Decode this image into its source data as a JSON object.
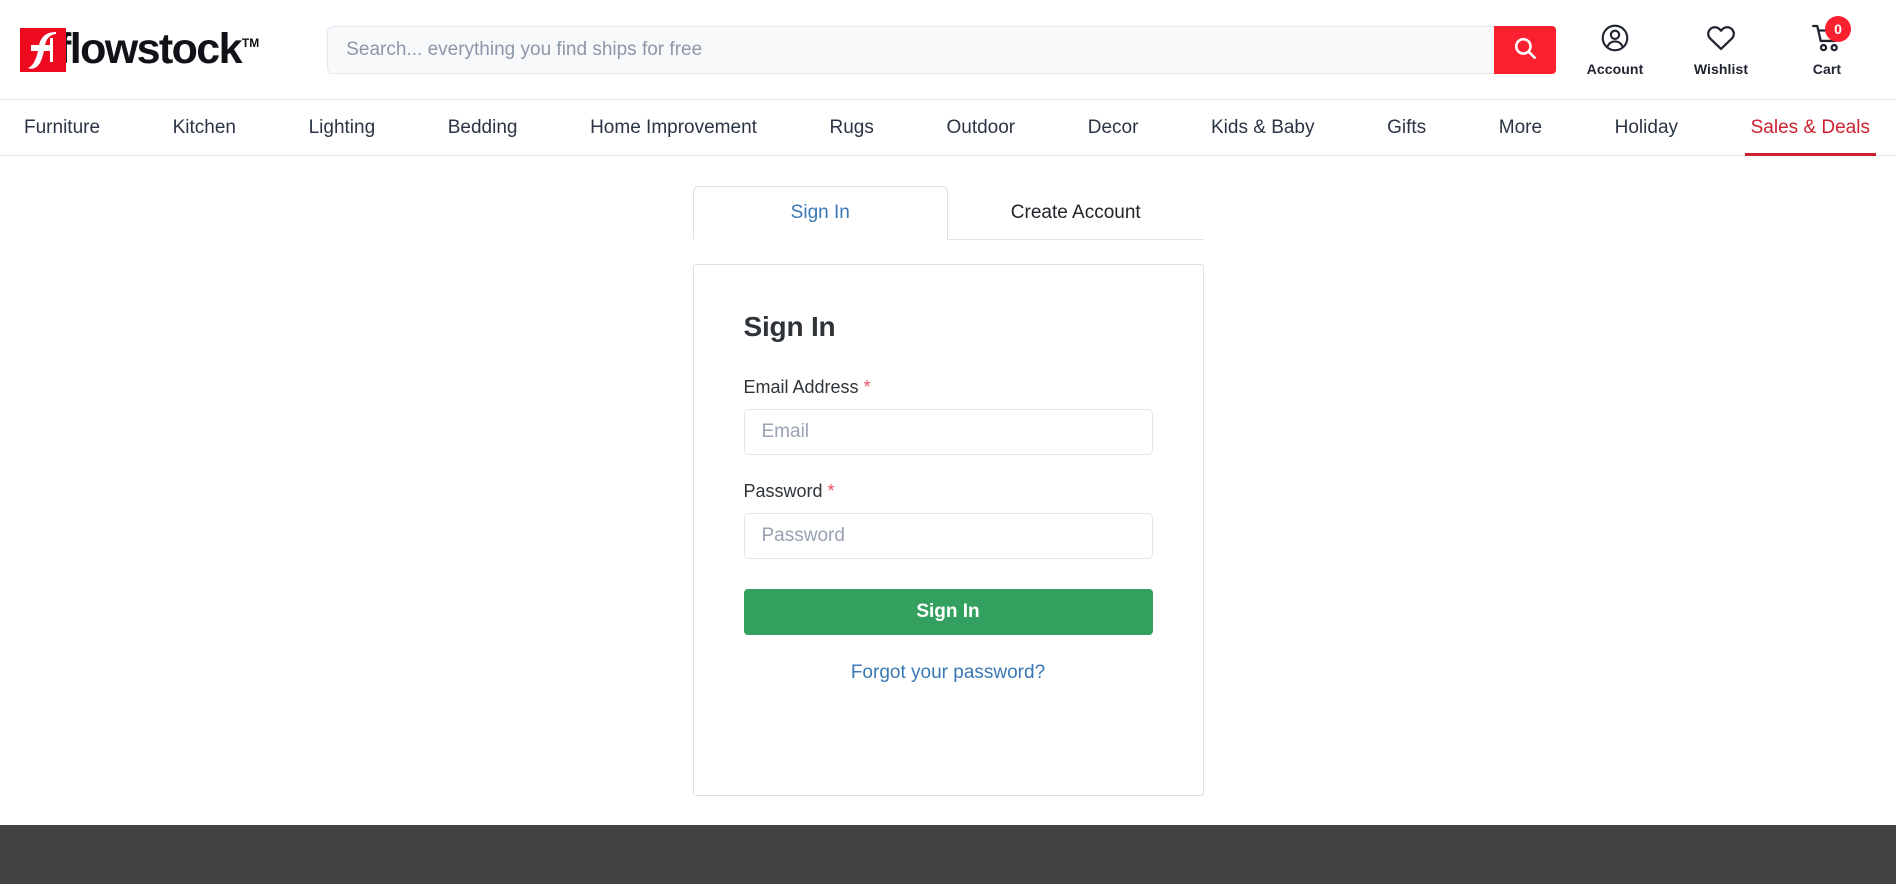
{
  "brand": {
    "name": "flowstock",
    "trademark": "TM",
    "mark_icon": "flowstock-f-logomark",
    "logo_red": "#ee0a1e"
  },
  "search": {
    "placeholder": "Search... everything you find ships for free",
    "value": "",
    "button_icon": "search-icon",
    "button_color": "#fb2030"
  },
  "header_actions": [
    {
      "label": "Account",
      "icon": "account-icon"
    },
    {
      "label": "Wishlist",
      "icon": "heart-icon"
    },
    {
      "label": "Cart",
      "icon": "cart-icon",
      "badge": "0"
    }
  ],
  "nav": {
    "items": [
      {
        "label": "Furniture",
        "active": false
      },
      {
        "label": "Kitchen",
        "active": false
      },
      {
        "label": "Lighting",
        "active": false
      },
      {
        "label": "Bedding",
        "active": false
      },
      {
        "label": "Home Improvement",
        "active": false
      },
      {
        "label": "Rugs",
        "active": false
      },
      {
        "label": "Outdoor",
        "active": false
      },
      {
        "label": "Decor",
        "active": false
      },
      {
        "label": "Kids & Baby",
        "active": false
      },
      {
        "label": "Gifts",
        "active": false
      },
      {
        "label": "More",
        "active": false
      },
      {
        "label": "Holiday",
        "active": false
      },
      {
        "label": "Sales & Deals",
        "active": true
      }
    ],
    "sale_color": "#cf2030"
  },
  "auth": {
    "tabs": [
      {
        "label": "Sign In",
        "active": true
      },
      {
        "label": "Create Account",
        "active": false
      }
    ],
    "card": {
      "title": "Sign In",
      "email": {
        "label": "Email Address",
        "required_marker": "*",
        "placeholder": "Email",
        "value": ""
      },
      "password": {
        "label": "Password",
        "required_marker": "*",
        "placeholder": "Password",
        "value": ""
      },
      "submit_label": "Sign In",
      "submit_color": "#34a05f",
      "forgot_label": "Forgot your password?",
      "link_color": "#3a78b5"
    }
  },
  "footer": {
    "background": "#434343"
  }
}
